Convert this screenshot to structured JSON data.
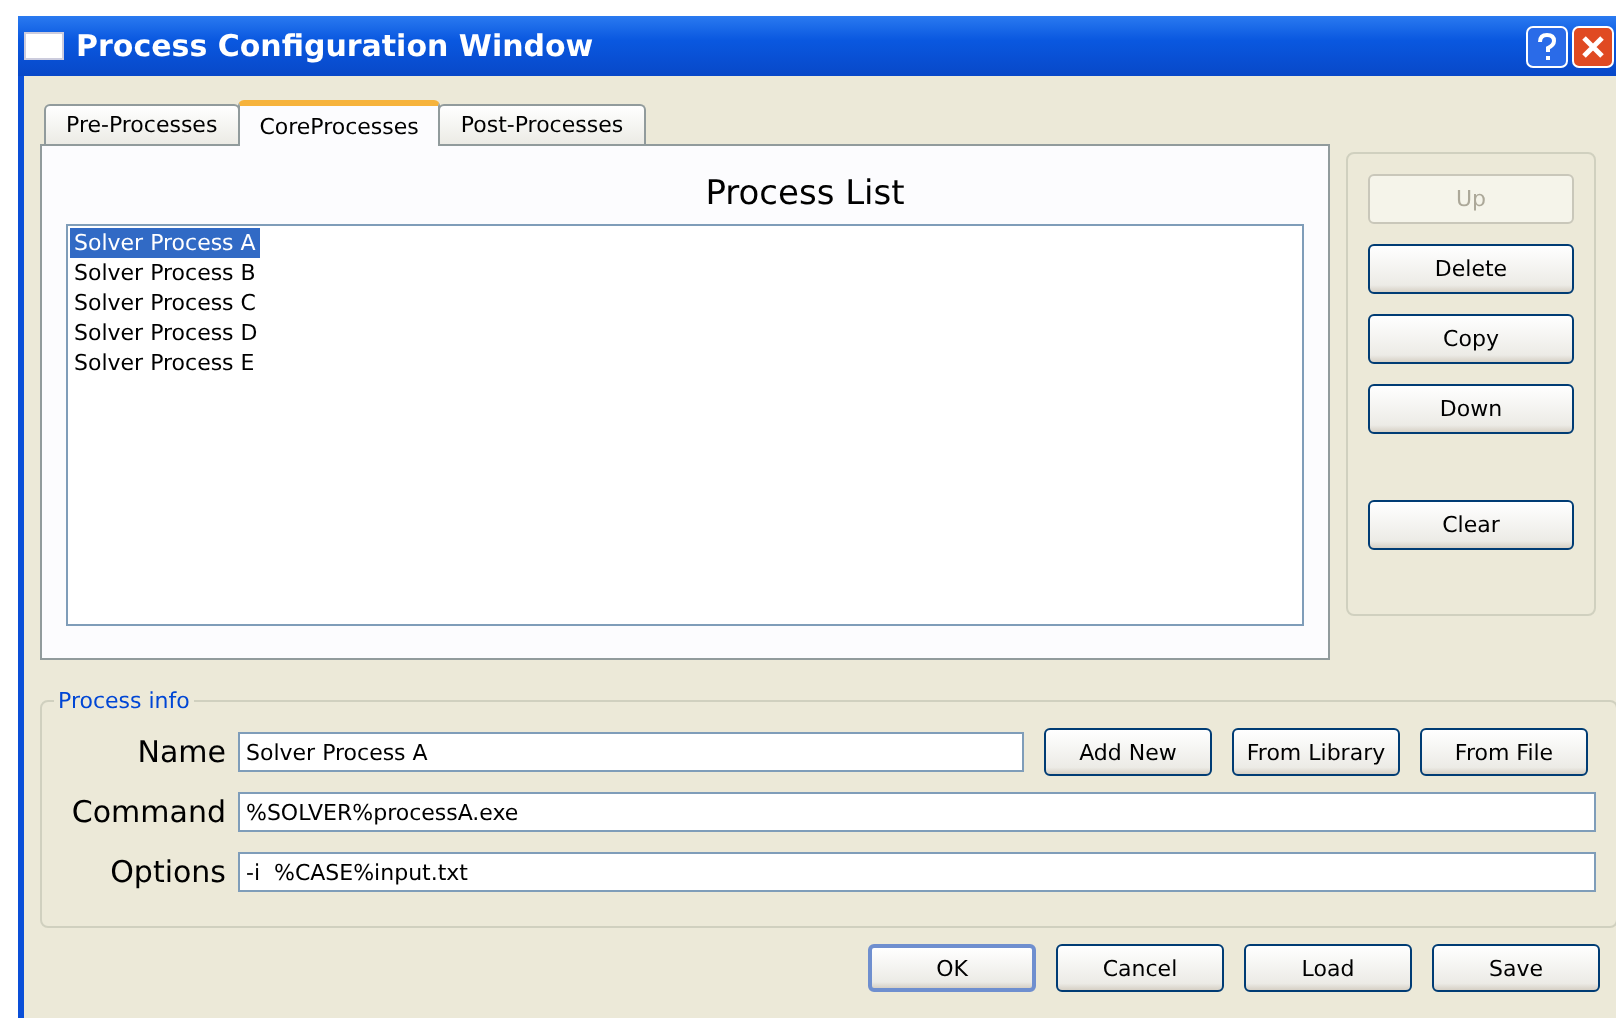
{
  "window": {
    "title": "Process Configuration Window"
  },
  "tabs": [
    {
      "label": "Pre-Processes",
      "selected": false
    },
    {
      "label": "CoreProcesses",
      "selected": true
    },
    {
      "label": "Post-Processes",
      "selected": false
    }
  ],
  "process_list": {
    "title": "Process List",
    "items": [
      {
        "label": "Solver Process A",
        "selected": true
      },
      {
        "label": "Solver Process B",
        "selected": false
      },
      {
        "label": "Solver Process C",
        "selected": false
      },
      {
        "label": "Solver Process D",
        "selected": false
      },
      {
        "label": "Solver Process E",
        "selected": false
      }
    ]
  },
  "side_buttons": [
    {
      "label": "Up",
      "disabled": true
    },
    {
      "label": "Delete",
      "disabled": false
    },
    {
      "label": "Copy",
      "disabled": false
    },
    {
      "label": "Down",
      "disabled": false
    },
    {
      "label": "Clear",
      "disabled": false
    }
  ],
  "process_info": {
    "title": "Process info",
    "fields": [
      {
        "label": "Name",
        "value": "Solver Process A"
      },
      {
        "label": "Command",
        "value": "%SOLVER%processA.exe"
      },
      {
        "label": "Options",
        "value": "-i  %CASE%input.txt"
      }
    ],
    "buttons": [
      "Add New",
      "From Library",
      "From File"
    ]
  },
  "footer_buttons": [
    {
      "label": "OK",
      "default": true
    },
    {
      "label": "Cancel",
      "default": false
    },
    {
      "label": "Load",
      "default": false
    },
    {
      "label": "Save",
      "default": false
    }
  ]
}
